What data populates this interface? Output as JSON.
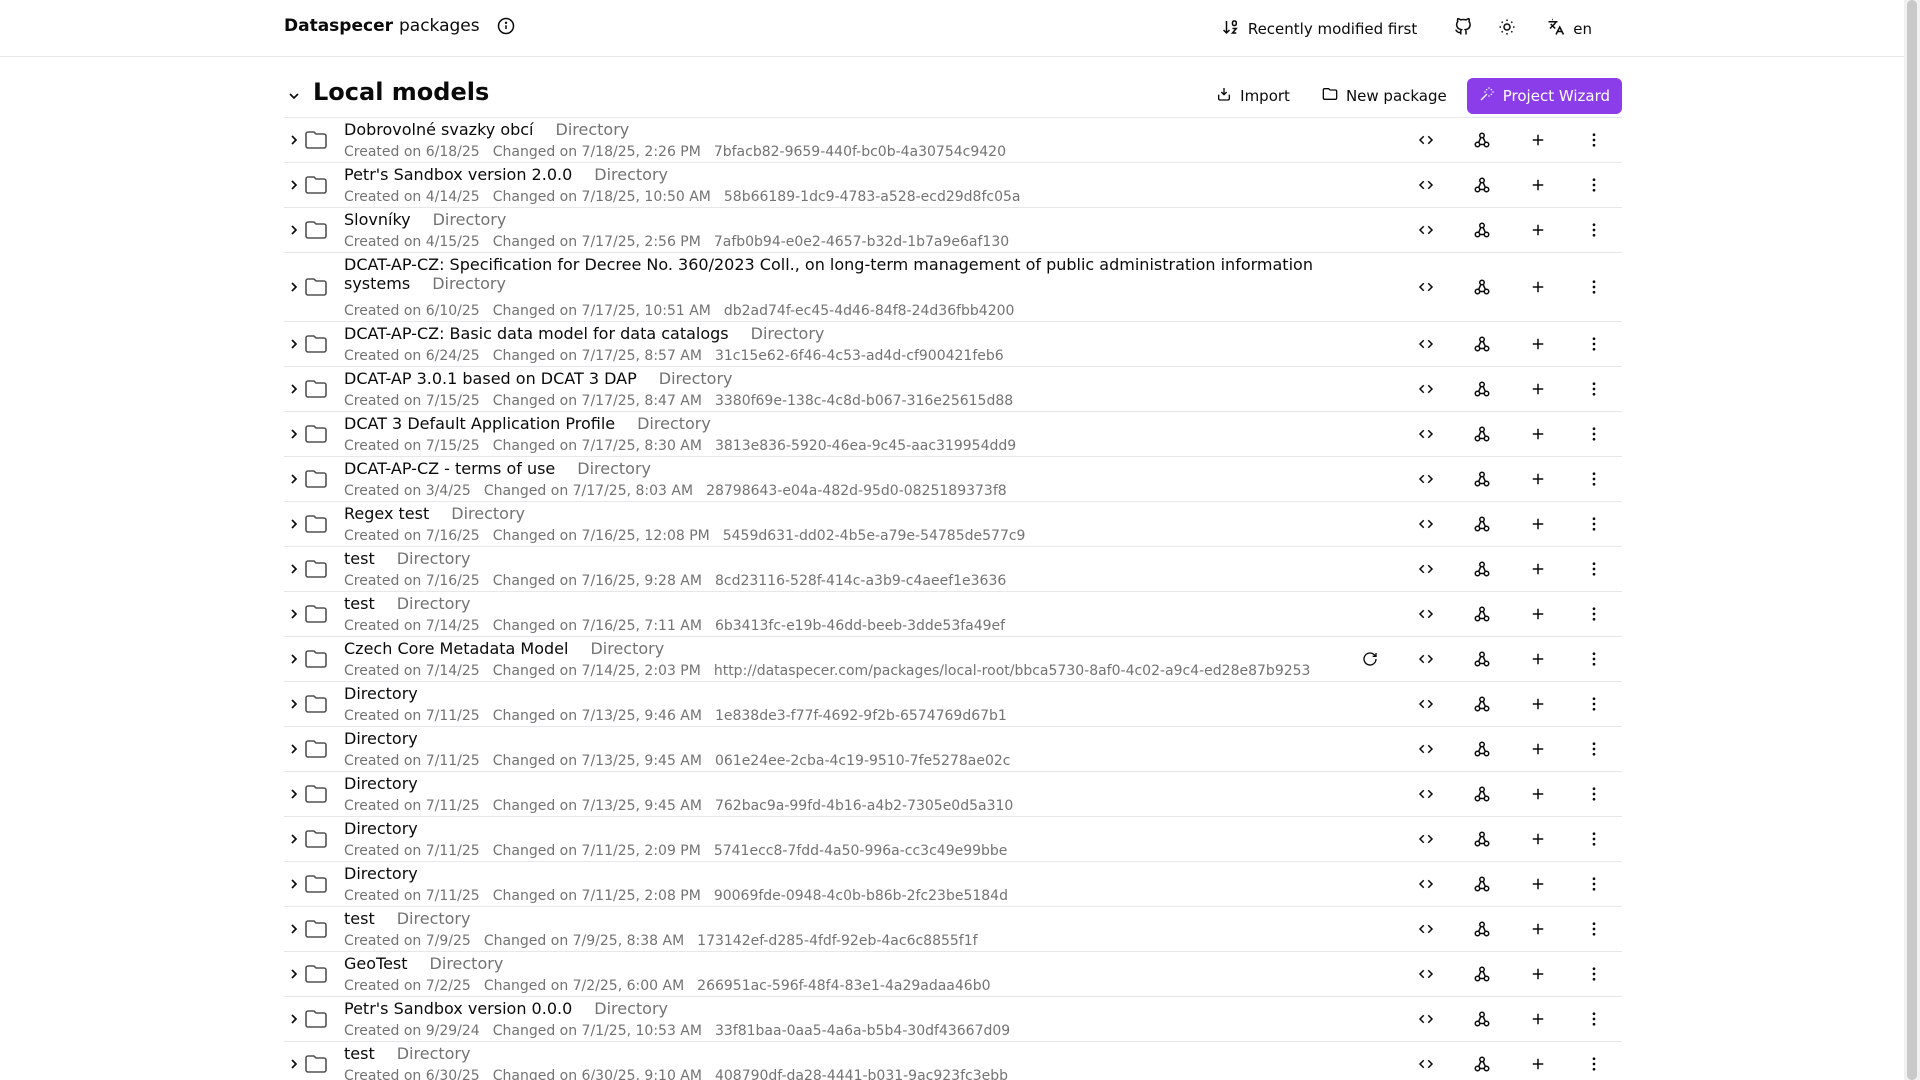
{
  "header": {
    "brand_strong": "Dataspecer",
    "brand_rest": "packages",
    "sort_label": "Recently modified first",
    "language": "en"
  },
  "section": {
    "title": "Local models",
    "import_label": "Import",
    "new_package_label": "New package",
    "wizard_label": "Project Wizard"
  },
  "colors": {
    "accent": "#8b3dea",
    "muted": "#737373",
    "border": "#e5e7eb"
  },
  "icons": [
    "info-icon",
    "sort-icon",
    "github-icon",
    "sun-icon",
    "language-icon",
    "chevron-down-icon",
    "import-icon",
    "folder-icon",
    "wand-icon",
    "chevron-right-icon",
    "code-icon",
    "graph-icon",
    "plus-icon",
    "more-vertical-icon",
    "refresh-icon"
  ],
  "rows": [
    {
      "name": "Dobrovolné svazky obcí",
      "type": "Directory",
      "created": "Created on 6/18/25",
      "changed": "Changed on 7/18/25, 2:26 PM",
      "id": "7bfacb82-9659-440f-bc0b-4a30754c9420"
    },
    {
      "name": "Petr's Sandbox version 2.0.0",
      "type": "Directory",
      "created": "Created on 4/14/25",
      "changed": "Changed on 7/18/25, 10:50 AM",
      "id": "58b66189-1dc9-4783-a528-ecd29d8fc05a"
    },
    {
      "name": "Slovníky",
      "type": "Directory",
      "created": "Created on 4/15/25",
      "changed": "Changed on 7/17/25, 2:56 PM",
      "id": "7afb0b94-e0e2-4657-b32d-1b7a9e6af130"
    },
    {
      "name": "DCAT-AP-CZ: Specification for Decree No. 360/2023 Coll., on long-term management of public administration information systems",
      "type": "Directory",
      "created": "Created on 6/10/25",
      "changed": "Changed on 7/17/25, 10:51 AM",
      "id": "db2ad74f-ec45-4d46-84f8-24d36fbb4200"
    },
    {
      "name": "DCAT-AP-CZ: Basic data model for data catalogs",
      "type": "Directory",
      "created": "Created on 6/24/25",
      "changed": "Changed on 7/17/25, 8:57 AM",
      "id": "31c15e62-6f46-4c53-ad4d-cf900421feb6"
    },
    {
      "name": "DCAT-AP 3.0.1 based on DCAT 3 DAP",
      "type": "Directory",
      "created": "Created on 7/15/25",
      "changed": "Changed on 7/17/25, 8:47 AM",
      "id": "3380f69e-138c-4c8d-b067-316e25615d88"
    },
    {
      "name": "DCAT 3 Default Application Profile",
      "type": "Directory",
      "created": "Created on 7/15/25",
      "changed": "Changed on 7/17/25, 8:30 AM",
      "id": "3813e836-5920-46ea-9c45-aac319954dd9"
    },
    {
      "name": "DCAT-AP-CZ - terms of use",
      "type": "Directory",
      "created": "Created on 3/4/25",
      "changed": "Changed on 7/17/25, 8:03 AM",
      "id": "28798643-e04a-482d-95d0-0825189373f8"
    },
    {
      "name": "Regex test",
      "type": "Directory",
      "created": "Created on 7/16/25",
      "changed": "Changed on 7/16/25, 12:08 PM",
      "id": "5459d631-dd02-4b5e-a79e-54785de577c9"
    },
    {
      "name": "test",
      "type": "Directory",
      "created": "Created on 7/16/25",
      "changed": "Changed on 7/16/25, 9:28 AM",
      "id": "8cd23116-528f-414c-a3b9-c4aeef1e3636"
    },
    {
      "name": "test",
      "type": "Directory",
      "created": "Created on 7/14/25",
      "changed": "Changed on 7/16/25, 7:11 AM",
      "id": "6b3413fc-e19b-46dd-beeb-3dde53fa49ef"
    },
    {
      "name": "Czech Core Metadata Model",
      "type": "Directory",
      "created": "Created on 7/14/25",
      "changed": "Changed on 7/14/25, 2:03 PM",
      "id": "http://dataspecer.com/packages/local-root/bbca5730-8af0-4c02-a9c4-ed28e87b9253"
    },
    {
      "name": "Directory",
      "type": "",
      "created": "Created on 7/11/25",
      "changed": "Changed on 7/13/25, 9:46 AM",
      "id": "1e838de3-f77f-4692-9f2b-6574769d67b1"
    },
    {
      "name": "Directory",
      "type": "",
      "created": "Created on 7/11/25",
      "changed": "Changed on 7/13/25, 9:45 AM",
      "id": "061e24ee-2cba-4c19-9510-7fe5278ae02c"
    },
    {
      "name": "Directory",
      "type": "",
      "created": "Created on 7/11/25",
      "changed": "Changed on 7/13/25, 9:45 AM",
      "id": "762bac9a-99fd-4b16-a4b2-7305e0d5a310"
    },
    {
      "name": "Directory",
      "type": "",
      "created": "Created on 7/11/25",
      "changed": "Changed on 7/11/25, 2:09 PM",
      "id": "5741ecc8-7fdd-4a50-996a-cc3c49e99bbe"
    },
    {
      "name": "Directory",
      "type": "",
      "created": "Created on 7/11/25",
      "changed": "Changed on 7/11/25, 2:08 PM",
      "id": "90069fde-0948-4c0b-b86b-2fc23be5184d"
    },
    {
      "name": "test",
      "type": "Directory",
      "created": "Created on 7/9/25",
      "changed": "Changed on 7/9/25, 8:38 AM",
      "id": "173142ef-d285-4fdf-92eb-4ac6c8855f1f"
    },
    {
      "name": "GeoTest",
      "type": "Directory",
      "created": "Created on 7/2/25",
      "changed": "Changed on 7/2/25, 6:00 AM",
      "id": "266951ac-596f-48f4-83e1-4a29adaa46b0"
    },
    {
      "name": "Petr's Sandbox version 0.0.0",
      "type": "Directory",
      "created": "Created on 9/29/24",
      "changed": "Changed on 7/1/25, 10:53 AM",
      "id": "33f81baa-0aa5-4a6a-b5b4-30df43667d09"
    },
    {
      "name": "test",
      "type": "Directory",
      "created": "Created on 6/30/25",
      "changed": "Changed on 6/30/25, 9:10 AM",
      "id": "408790df-da28-4441-b031-9ac923fc3ebb"
    }
  ]
}
